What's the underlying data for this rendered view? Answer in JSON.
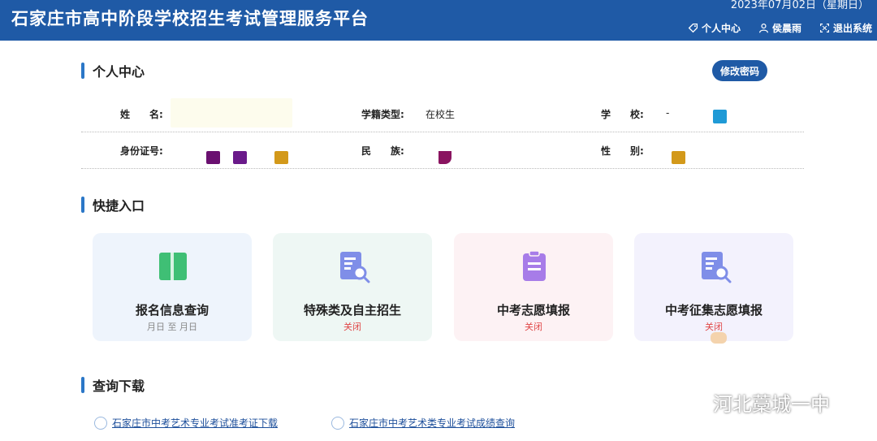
{
  "header": {
    "title": "石家庄市高中阶段学校招生考试管理服务平台",
    "datetime": "2023年07月02日（星期日）",
    "nav": [
      {
        "label": "个人中心",
        "icon": "tag-icon"
      },
      {
        "label": "侯晨雨",
        "icon": "user-icon"
      },
      {
        "label": "退出系统",
        "icon": "exit-icon"
      }
    ]
  },
  "profile": {
    "section_title": "个人中心",
    "change_password": "修改密码",
    "fields": {
      "name_label": "姓　　名:",
      "type_label": "学籍类型:",
      "type_value": "在校生",
      "school_label": "学　　校:",
      "school_value": "-",
      "id_label": "身份证号:",
      "ethnic_label": "民　　族:",
      "gender_label": "性　　别:"
    }
  },
  "shortcuts": {
    "section_title": "快捷入口",
    "cards": [
      {
        "title": "报名信息查询",
        "sub": "月日 至 月日",
        "status_color": "#888888",
        "bg": "#eef4fc",
        "icon": "book-icon"
      },
      {
        "title": "特殊类及自主招生",
        "sub": "关闭",
        "status_color": "#e04545",
        "bg": "#eef7f4",
        "icon": "document-search-icon"
      },
      {
        "title": "中考志愿填报",
        "sub": "关闭",
        "status_color": "#e04545",
        "bg": "#fdf2f4",
        "icon": "clipboard-icon"
      },
      {
        "title": "中考征集志愿填报",
        "sub": "关闭",
        "status_color": "#e04545",
        "bg": "#f3f2fd",
        "icon": "document-search-icon"
      }
    ]
  },
  "downloads": {
    "section_title": "查询下载",
    "links": [
      "石家庄市中考艺术专业考试准考证下载",
      "石家庄市中考艺术类专业考试成绩查询"
    ]
  },
  "watermark": "河北藁城一中"
}
